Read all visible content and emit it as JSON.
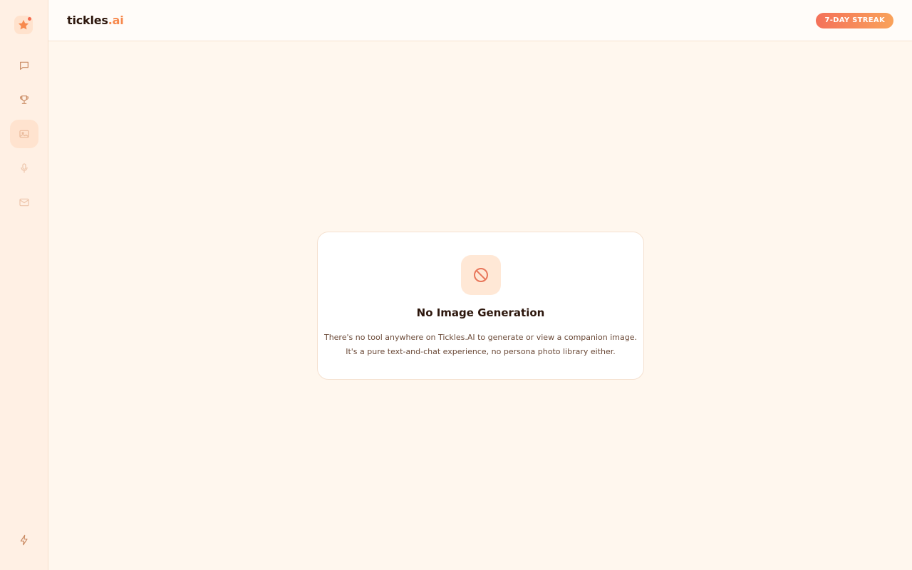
{
  "app": {
    "logo_main": "tickles",
    "logo_accent": ".ai",
    "streak_label": "7-DAY STREAK"
  },
  "colors": {
    "accent": "#f7894d",
    "accent_red": "#f46a4e",
    "background": "#fff7ee"
  },
  "sidebar": {
    "brand_icon": "star-icon",
    "items": [
      {
        "icon": "chat-icon",
        "active": false
      },
      {
        "icon": "trophy-icon",
        "active": false
      },
      {
        "icon": "image-icon",
        "active": true
      },
      {
        "icon": "microphone-icon",
        "active": false
      },
      {
        "icon": "mail-icon",
        "active": false
      }
    ],
    "bottom_icon": "lightning-icon"
  },
  "notice": {
    "icon": "prohibited-icon",
    "title": "No Image Generation",
    "line1": "There's no tool anywhere on Tickles.AI to generate or view a companion image.",
    "line2": "It's a pure text-and-chat experience, no persona photo library either."
  }
}
